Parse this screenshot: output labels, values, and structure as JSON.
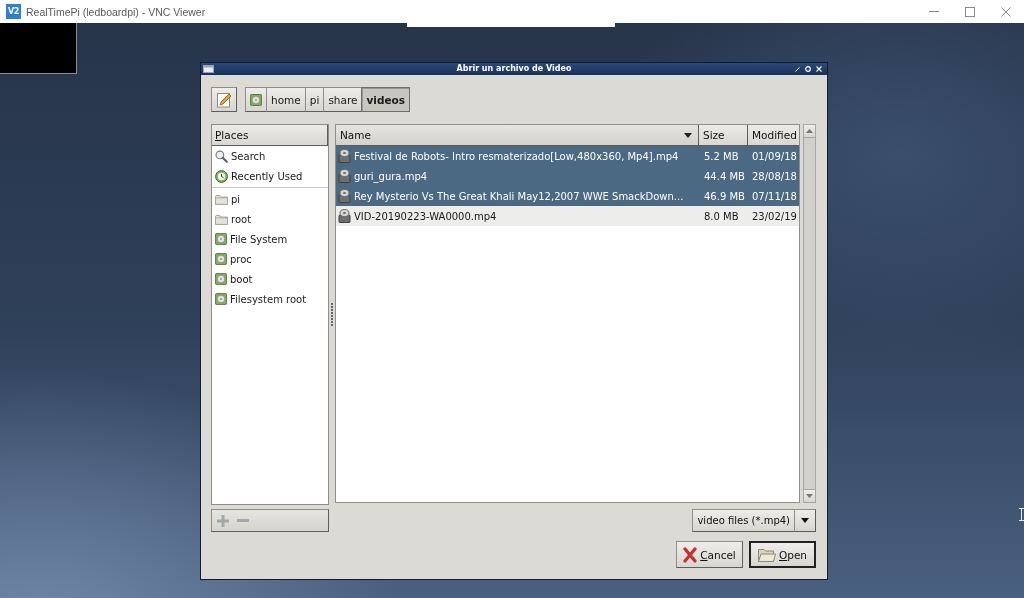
{
  "vnc_window": {
    "logo": "V2",
    "title": "RealTimePi (ledboardpi) - VNC Viewer"
  },
  "dialog": {
    "title": "Abrir un archivo de Video",
    "path": [
      {
        "kind": "root",
        "selected": false
      },
      {
        "kind": "folder",
        "label": "home",
        "selected": false
      },
      {
        "kind": "folder",
        "label": "pi",
        "selected": false
      },
      {
        "kind": "folder",
        "label": "share",
        "selected": false
      },
      {
        "kind": "folder",
        "label": "videos",
        "selected": true
      }
    ],
    "places": {
      "header": "Places",
      "sections": [
        {
          "items": [
            {
              "kind": "search",
              "label": "Search",
              "selected": false
            },
            {
              "kind": "recent",
              "label": "Recently Used",
              "selected": false
            }
          ]
        },
        {
          "items": [
            {
              "kind": "folder",
              "label": "pi",
              "selected": false
            },
            {
              "kind": "folder",
              "label": "root",
              "selected": false
            },
            {
              "kind": "drive",
              "label": "File System",
              "selected": false
            },
            {
              "kind": "drive",
              "label": "proc",
              "selected": false
            },
            {
              "kind": "drive",
              "label": "boot",
              "selected": false
            },
            {
              "kind": "drive",
              "label": "Filesystem root",
              "selected": false
            }
          ]
        }
      ]
    },
    "files": {
      "columns": [
        {
          "label": "Name",
          "sorted": true
        },
        {
          "label": "Size",
          "sorted": false
        },
        {
          "label": "Modified",
          "sorted": false
        }
      ],
      "rows": [
        {
          "name": "Festival de Robots- Intro resmaterizado[Low,480x360, Mp4].mp4",
          "size": "5.2 MB",
          "modified": "01/09/18",
          "selected": true
        },
        {
          "name": "guri_gura.mp4",
          "size": "44.4 MB",
          "modified": "28/08/18",
          "selected": true
        },
        {
          "name": "Rey Mysterio Vs The Great Khali May12,2007 WWE SmackDown...",
          "size": "46.9 MB",
          "modified": "07/11/18",
          "selected": true
        },
        {
          "name": "VID-20190223-WA0000.mp4",
          "size": "8.0 MB",
          "modified": "23/02/19",
          "selected": false
        }
      ]
    },
    "bookmark_buttons": [
      {
        "kind": "add",
        "disabled": true
      },
      {
        "kind": "remove",
        "disabled": true
      }
    ],
    "filter": {
      "value": "video files (*.mp4)"
    },
    "buttons": [
      {
        "kind": "cancel",
        "label": "Cancel",
        "default": false
      },
      {
        "kind": "open",
        "label": "Open",
        "default": true
      }
    ]
  }
}
